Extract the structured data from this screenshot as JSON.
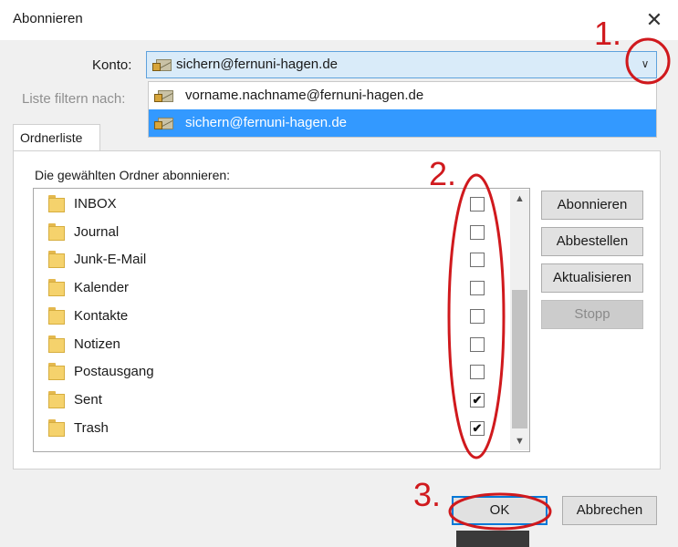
{
  "window": {
    "title": "Abonnieren",
    "close_glyph": "✕"
  },
  "account": {
    "label": "Konto:",
    "selected": "sichern@fernuni-hagen.de",
    "options": [
      {
        "label": "vorname.nachname@fernuni-hagen.de",
        "selected": false
      },
      {
        "label": "sichern@fernuni-hagen.de",
        "selected": true
      }
    ]
  },
  "filter": {
    "label": "Liste filtern nach:"
  },
  "tabs": [
    {
      "label": "Ordnerliste",
      "active": true
    }
  ],
  "list": {
    "caption": "Die gewählten Ordner abonnieren:",
    "folders": [
      {
        "name": "INBOX",
        "subscribed": false
      },
      {
        "name": "Journal",
        "subscribed": false
      },
      {
        "name": "Junk-E-Mail",
        "subscribed": false
      },
      {
        "name": "Kalender",
        "subscribed": false
      },
      {
        "name": "Kontakte",
        "subscribed": false
      },
      {
        "name": "Notizen",
        "subscribed": false
      },
      {
        "name": "Postausgang",
        "subscribed": false
      },
      {
        "name": "Sent",
        "subscribed": true
      },
      {
        "name": "Trash",
        "subscribed": true
      }
    ]
  },
  "buttons": {
    "subscribe": "Abonnieren",
    "unsubscribe": "Abbestellen",
    "refresh": "Aktualisieren",
    "stop": "Stopp",
    "ok": "OK",
    "cancel": "Abbrechen"
  },
  "annotations": {
    "step1": "1.",
    "step2": "2.",
    "step3": "3.",
    "color": "#d0191d"
  },
  "icons": {
    "account": "mail-account-icon",
    "folder": "folder-icon",
    "dropdown": "chevron-down-icon",
    "scroll_up": "scroll-up-arrow-icon",
    "scroll_down": "scroll-down-arrow-icon"
  }
}
